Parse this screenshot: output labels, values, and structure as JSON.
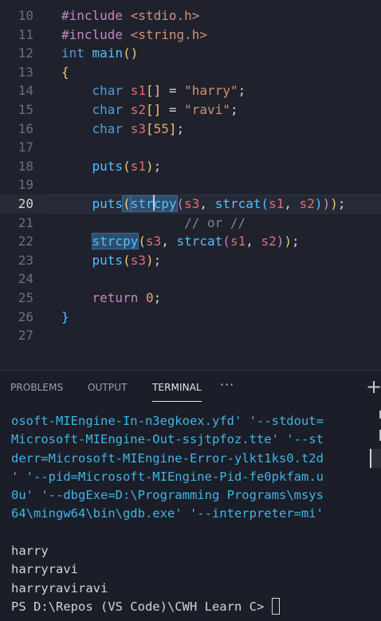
{
  "editor": {
    "active_line": 20,
    "lines": [
      {
        "n": "10",
        "code": "#include <stdio.h>"
      },
      {
        "n": "11",
        "code": "#include <string.h>"
      },
      {
        "n": "12",
        "code": "int main()"
      },
      {
        "n": "13",
        "code": "{"
      },
      {
        "n": "14",
        "code": "    char s1[] = \"harry\";"
      },
      {
        "n": "15",
        "code": "    char s2[] = \"ravi\";"
      },
      {
        "n": "16",
        "code": "    char s3[55];"
      },
      {
        "n": "17",
        "code": ""
      },
      {
        "n": "18",
        "code": "    puts(s1);"
      },
      {
        "n": "19",
        "code": ""
      },
      {
        "n": "20",
        "code": "    puts(strcpy(s3, strcat(s1, s2)));"
      },
      {
        "n": "21",
        "code": "                // or //"
      },
      {
        "n": "22",
        "code": "    strcpy(s3, strcat(s1, s2));"
      },
      {
        "n": "23",
        "code": "    puts(s3);"
      },
      {
        "n": "24",
        "code": ""
      },
      {
        "n": "25",
        "code": "    return 0;"
      },
      {
        "n": "26",
        "code": "}"
      },
      {
        "n": "27",
        "code": ""
      }
    ]
  },
  "panel": {
    "tabs": [
      {
        "label": "PROBLEMS",
        "active": false
      },
      {
        "label": "OUTPUT",
        "active": false
      },
      {
        "label": "TERMINAL",
        "active": true
      }
    ],
    "more_label": "···",
    "add_label": "+"
  },
  "terminal": {
    "command_lines": [
      "osoft-MIEngine-In-n3egkoex.yfd' '--stdout=",
      "Microsoft-MIEngine-Out-ssjtpfoz.tte' '--st",
      "derr=Microsoft-MIEngine-Error-ylkt1ks0.t2d",
      "' '--pid=Microsoft-MIEngine-Pid-fe0pkfam.u",
      "0u' '--dbgExe=D:\\Programming Programs\\msys",
      "64\\mingw64\\bin\\gdb.exe' '--interpreter=mi'"
    ],
    "output_lines": [
      "harry",
      "harryravi",
      "harryraviravi"
    ],
    "prompt": "PS D:\\Repos (VS Code)\\CWH Learn C> "
  },
  "colors": {
    "editor_bg": "#1f222d",
    "panel_bg": "#1b1e28",
    "keyword": "#c586c0",
    "function": "#4fc1ff",
    "string": "#ce9178",
    "variable": "#e06c75",
    "number": "#f0a05a",
    "terminal_link": "#3fb5e6"
  }
}
